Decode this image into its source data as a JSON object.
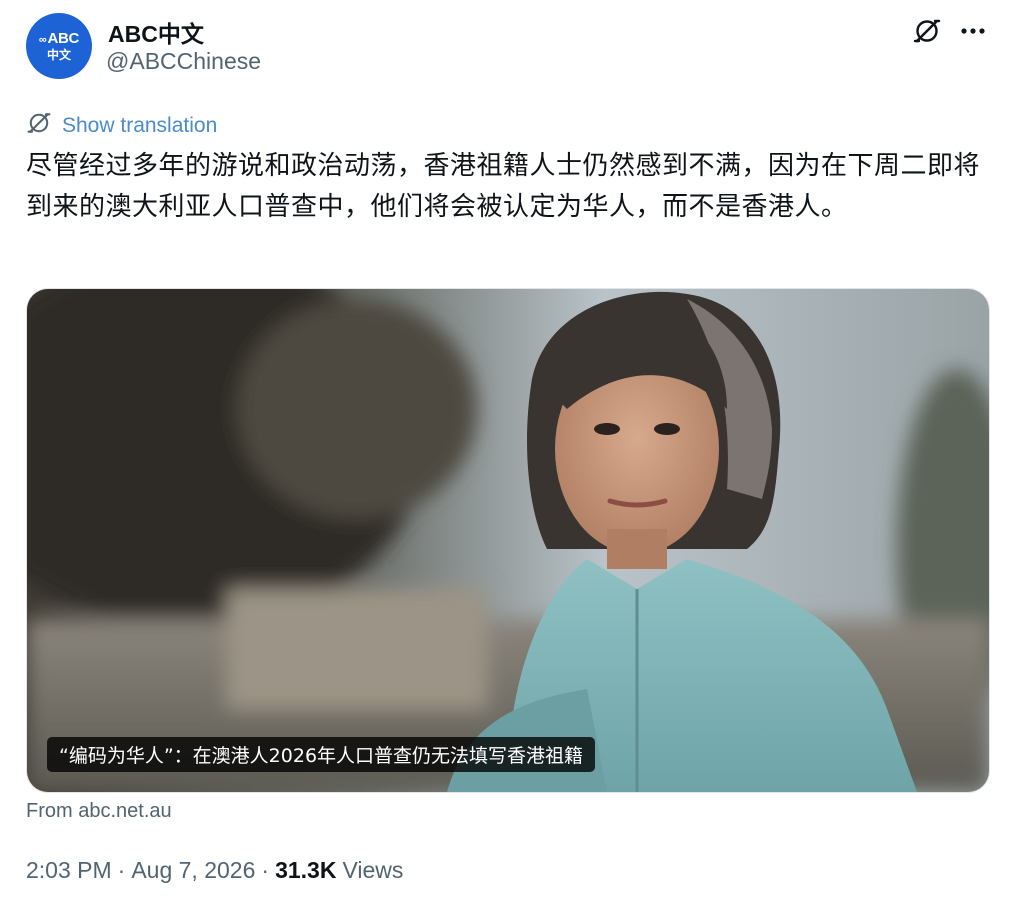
{
  "account": {
    "avatar_text_line1": "ABC",
    "avatar_text_line2": "中文",
    "display_name": "ABC中文",
    "handle": "@ABCChinese"
  },
  "icons": {
    "translate": "translate-icon",
    "more": "more-options-icon",
    "avatar_mark": "abc-logo-icon"
  },
  "translation": {
    "label": "Show translation"
  },
  "tweet": {
    "text": "尽管经过多年的游说和政治动荡，香港祖籍人士仍然感到不满，因为在下周二即将到来的澳大利亚人口普查中，他们将会被认定为华人，而不是香港人。"
  },
  "card": {
    "title": "“编码为华人”：在澳港人2026年人口普查仍无法填写香港祖籍",
    "source": "From abc.net.au"
  },
  "meta": {
    "time": "2:03 PM",
    "separator": "·",
    "date": "Aug 7, 2026",
    "views_count": "31.3K",
    "views_label": "Views"
  },
  "colors": {
    "avatar_bg": "#1d63d6",
    "link_blue": "#4b8bcc",
    "muted_text": "#536471",
    "main_text": "#0f1419"
  }
}
